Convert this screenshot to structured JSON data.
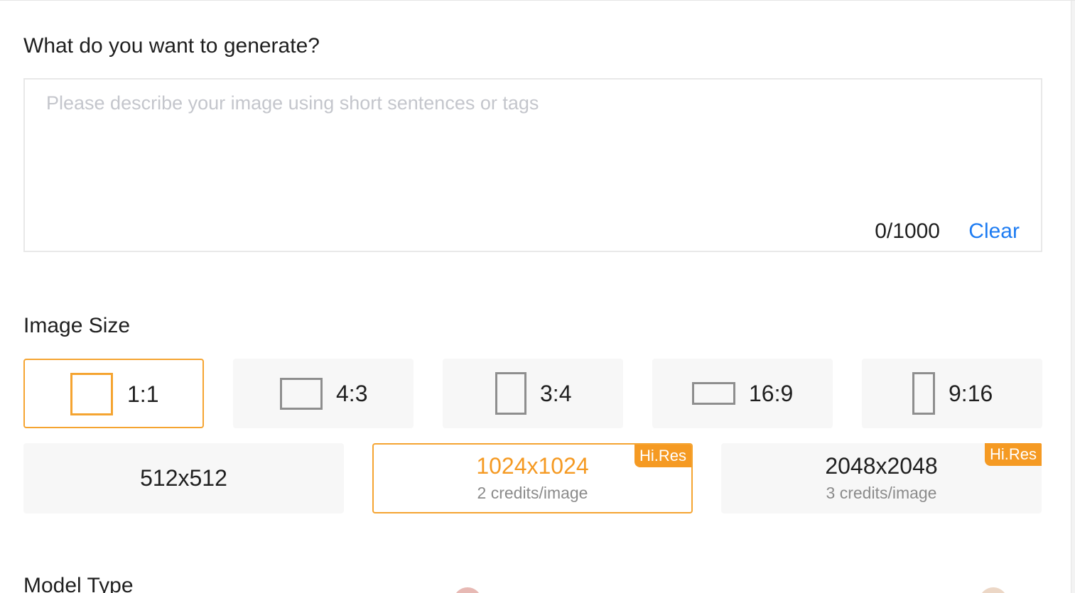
{
  "prompt": {
    "title": "What do you want to generate?",
    "placeholder": "Please describe your image using short sentences or tags",
    "value": "",
    "counter": "0/1000",
    "clear_label": "Clear"
  },
  "image_size": {
    "title": "Image Size",
    "ratios": [
      {
        "label": "1:1",
        "icon": "square-ratio-icon",
        "selected": true
      },
      {
        "label": "4:3",
        "icon": "landscape-4-3-ratio-icon",
        "selected": false
      },
      {
        "label": "3:4",
        "icon": "portrait-3-4-ratio-icon",
        "selected": false
      },
      {
        "label": "16:9",
        "icon": "landscape-16-9-ratio-icon",
        "selected": false
      },
      {
        "label": "9:16",
        "icon": "portrait-9-16-ratio-icon",
        "selected": false
      }
    ],
    "resolutions": [
      {
        "label": "512x512",
        "credits": "",
        "badge": "",
        "selected": false
      },
      {
        "label": "1024x1024",
        "credits": "2 credits/image",
        "badge": "Hi.Res",
        "selected": true
      },
      {
        "label": "2048x2048",
        "credits": "3 credits/image",
        "badge": "Hi.Res",
        "selected": false
      }
    ]
  },
  "model_type": {
    "title": "Model Type"
  },
  "colors": {
    "accent": "#f59a23",
    "link": "#1e7cf2",
    "card_bg": "#f7f7f7",
    "placeholder": "#c4c6cc"
  }
}
